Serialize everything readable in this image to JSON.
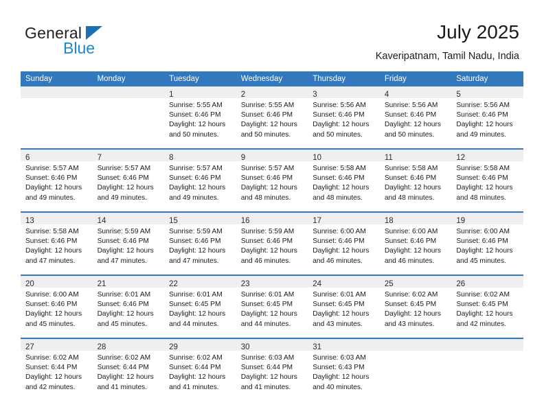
{
  "brand": {
    "name_top": "General",
    "name_bottom": "Blue",
    "triangle_color": "#1f6fb5",
    "blue_color": "#1a86d0"
  },
  "header": {
    "title": "July 2025",
    "subtitle": "Kaveripatnam, Tamil Nadu, India"
  },
  "theme": {
    "header_bg": "#3178be",
    "daynum_bg": "#efefef",
    "row_border": "#3178be",
    "text": "#1a1a1a"
  },
  "weekday_headers": [
    "Sunday",
    "Monday",
    "Tuesday",
    "Wednesday",
    "Thursday",
    "Friday",
    "Saturday"
  ],
  "labels": {
    "sunrise_prefix": "Sunrise:",
    "sunset_prefix": "Sunset:",
    "daylight_prefix": "Daylight:"
  },
  "weeks": [
    [
      {
        "day": "",
        "empty": true,
        "line1": "",
        "line2": "",
        "line3": "",
        "line4": ""
      },
      {
        "day": "",
        "empty": true,
        "line1": "",
        "line2": "",
        "line3": "",
        "line4": ""
      },
      {
        "day": "1",
        "empty": false,
        "line1": "Sunrise: 5:55 AM",
        "line2": "Sunset: 6:46 PM",
        "line3": "Daylight: 12 hours",
        "line4": "and 50 minutes."
      },
      {
        "day": "2",
        "empty": false,
        "line1": "Sunrise: 5:55 AM",
        "line2": "Sunset: 6:46 PM",
        "line3": "Daylight: 12 hours",
        "line4": "and 50 minutes."
      },
      {
        "day": "3",
        "empty": false,
        "line1": "Sunrise: 5:56 AM",
        "line2": "Sunset: 6:46 PM",
        "line3": "Daylight: 12 hours",
        "line4": "and 50 minutes."
      },
      {
        "day": "4",
        "empty": false,
        "line1": "Sunrise: 5:56 AM",
        "line2": "Sunset: 6:46 PM",
        "line3": "Daylight: 12 hours",
        "line4": "and 50 minutes."
      },
      {
        "day": "5",
        "empty": false,
        "line1": "Sunrise: 5:56 AM",
        "line2": "Sunset: 6:46 PM",
        "line3": "Daylight: 12 hours",
        "line4": "and 49 minutes."
      }
    ],
    [
      {
        "day": "6",
        "empty": false,
        "line1": "Sunrise: 5:57 AM",
        "line2": "Sunset: 6:46 PM",
        "line3": "Daylight: 12 hours",
        "line4": "and 49 minutes."
      },
      {
        "day": "7",
        "empty": false,
        "line1": "Sunrise: 5:57 AM",
        "line2": "Sunset: 6:46 PM",
        "line3": "Daylight: 12 hours",
        "line4": "and 49 minutes."
      },
      {
        "day": "8",
        "empty": false,
        "line1": "Sunrise: 5:57 AM",
        "line2": "Sunset: 6:46 PM",
        "line3": "Daylight: 12 hours",
        "line4": "and 49 minutes."
      },
      {
        "day": "9",
        "empty": false,
        "line1": "Sunrise: 5:57 AM",
        "line2": "Sunset: 6:46 PM",
        "line3": "Daylight: 12 hours",
        "line4": "and 48 minutes."
      },
      {
        "day": "10",
        "empty": false,
        "line1": "Sunrise: 5:58 AM",
        "line2": "Sunset: 6:46 PM",
        "line3": "Daylight: 12 hours",
        "line4": "and 48 minutes."
      },
      {
        "day": "11",
        "empty": false,
        "line1": "Sunrise: 5:58 AM",
        "line2": "Sunset: 6:46 PM",
        "line3": "Daylight: 12 hours",
        "line4": "and 48 minutes."
      },
      {
        "day": "12",
        "empty": false,
        "line1": "Sunrise: 5:58 AM",
        "line2": "Sunset: 6:46 PM",
        "line3": "Daylight: 12 hours",
        "line4": "and 48 minutes."
      }
    ],
    [
      {
        "day": "13",
        "empty": false,
        "line1": "Sunrise: 5:58 AM",
        "line2": "Sunset: 6:46 PM",
        "line3": "Daylight: 12 hours",
        "line4": "and 47 minutes."
      },
      {
        "day": "14",
        "empty": false,
        "line1": "Sunrise: 5:59 AM",
        "line2": "Sunset: 6:46 PM",
        "line3": "Daylight: 12 hours",
        "line4": "and 47 minutes."
      },
      {
        "day": "15",
        "empty": false,
        "line1": "Sunrise: 5:59 AM",
        "line2": "Sunset: 6:46 PM",
        "line3": "Daylight: 12 hours",
        "line4": "and 47 minutes."
      },
      {
        "day": "16",
        "empty": false,
        "line1": "Sunrise: 5:59 AM",
        "line2": "Sunset: 6:46 PM",
        "line3": "Daylight: 12 hours",
        "line4": "and 46 minutes."
      },
      {
        "day": "17",
        "empty": false,
        "line1": "Sunrise: 6:00 AM",
        "line2": "Sunset: 6:46 PM",
        "line3": "Daylight: 12 hours",
        "line4": "and 46 minutes."
      },
      {
        "day": "18",
        "empty": false,
        "line1": "Sunrise: 6:00 AM",
        "line2": "Sunset: 6:46 PM",
        "line3": "Daylight: 12 hours",
        "line4": "and 46 minutes."
      },
      {
        "day": "19",
        "empty": false,
        "line1": "Sunrise: 6:00 AM",
        "line2": "Sunset: 6:46 PM",
        "line3": "Daylight: 12 hours",
        "line4": "and 45 minutes."
      }
    ],
    [
      {
        "day": "20",
        "empty": false,
        "line1": "Sunrise: 6:00 AM",
        "line2": "Sunset: 6:46 PM",
        "line3": "Daylight: 12 hours",
        "line4": "and 45 minutes."
      },
      {
        "day": "21",
        "empty": false,
        "line1": "Sunrise: 6:01 AM",
        "line2": "Sunset: 6:46 PM",
        "line3": "Daylight: 12 hours",
        "line4": "and 45 minutes."
      },
      {
        "day": "22",
        "empty": false,
        "line1": "Sunrise: 6:01 AM",
        "line2": "Sunset: 6:45 PM",
        "line3": "Daylight: 12 hours",
        "line4": "and 44 minutes."
      },
      {
        "day": "23",
        "empty": false,
        "line1": "Sunrise: 6:01 AM",
        "line2": "Sunset: 6:45 PM",
        "line3": "Daylight: 12 hours",
        "line4": "and 44 minutes."
      },
      {
        "day": "24",
        "empty": false,
        "line1": "Sunrise: 6:01 AM",
        "line2": "Sunset: 6:45 PM",
        "line3": "Daylight: 12 hours",
        "line4": "and 43 minutes."
      },
      {
        "day": "25",
        "empty": false,
        "line1": "Sunrise: 6:02 AM",
        "line2": "Sunset: 6:45 PM",
        "line3": "Daylight: 12 hours",
        "line4": "and 43 minutes."
      },
      {
        "day": "26",
        "empty": false,
        "line1": "Sunrise: 6:02 AM",
        "line2": "Sunset: 6:45 PM",
        "line3": "Daylight: 12 hours",
        "line4": "and 42 minutes."
      }
    ],
    [
      {
        "day": "27",
        "empty": false,
        "line1": "Sunrise: 6:02 AM",
        "line2": "Sunset: 6:44 PM",
        "line3": "Daylight: 12 hours",
        "line4": "and 42 minutes."
      },
      {
        "day": "28",
        "empty": false,
        "line1": "Sunrise: 6:02 AM",
        "line2": "Sunset: 6:44 PM",
        "line3": "Daylight: 12 hours",
        "line4": "and 41 minutes."
      },
      {
        "day": "29",
        "empty": false,
        "line1": "Sunrise: 6:02 AM",
        "line2": "Sunset: 6:44 PM",
        "line3": "Daylight: 12 hours",
        "line4": "and 41 minutes."
      },
      {
        "day": "30",
        "empty": false,
        "line1": "Sunrise: 6:03 AM",
        "line2": "Sunset: 6:44 PM",
        "line3": "Daylight: 12 hours",
        "line4": "and 41 minutes."
      },
      {
        "day": "31",
        "empty": false,
        "line1": "Sunrise: 6:03 AM",
        "line2": "Sunset: 6:43 PM",
        "line3": "Daylight: 12 hours",
        "line4": "and 40 minutes."
      },
      {
        "day": "",
        "empty": true,
        "line1": "",
        "line2": "",
        "line3": "",
        "line4": ""
      },
      {
        "day": "",
        "empty": true,
        "line1": "",
        "line2": "",
        "line3": "",
        "line4": ""
      }
    ]
  ]
}
